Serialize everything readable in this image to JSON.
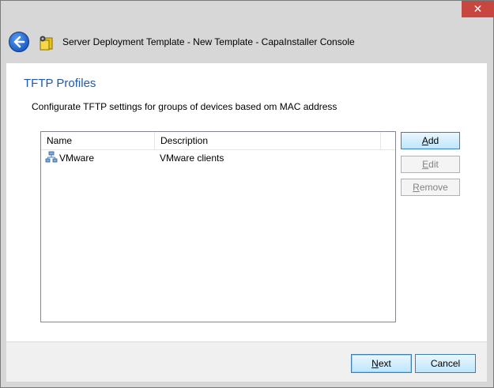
{
  "window": {
    "title": "Server Deployment Template - New Template - CapaInstaller Console",
    "close_glyph": "✕"
  },
  "page": {
    "heading": "TFTP Profiles",
    "subtitle": "Configurate TFTP settings for groups of devices based om MAC address"
  },
  "list": {
    "columns": [
      "Name",
      "Description"
    ],
    "rows": [
      {
        "name": "VMware",
        "description": "VMware clients",
        "icon": "network-group-icon"
      }
    ]
  },
  "side_buttons": {
    "add_accel": "A",
    "add_rest": "dd",
    "edit_accel": "E",
    "edit_rest": "dit",
    "remove_accel": "R",
    "remove_rest": "emove"
  },
  "footer": {
    "next_accel": "N",
    "next_rest": "ext",
    "cancel_label": "Cancel"
  },
  "colors": {
    "heading": "#1e5aa8",
    "close_button": "#c7463f",
    "button_border": "#3c7fb1"
  }
}
